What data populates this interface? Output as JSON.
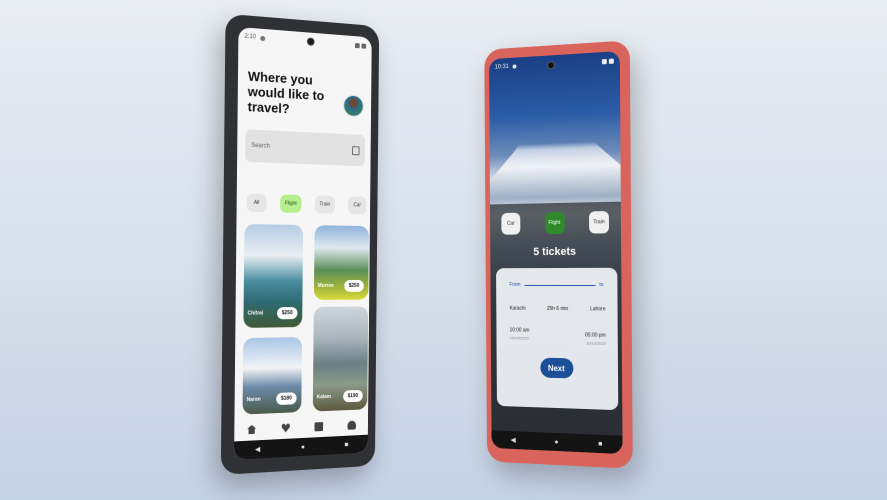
{
  "phone1": {
    "status": {
      "time": "2:10"
    },
    "title": "Where you would like to travel?",
    "search": {
      "placeholder": "Search"
    },
    "categories": [
      {
        "label": "All"
      },
      {
        "label": "Flight",
        "active": true
      },
      {
        "label": "Train"
      },
      {
        "label": "Car"
      }
    ],
    "destinations": [
      {
        "name": "Chitral",
        "price": "$250"
      },
      {
        "name": "Murree",
        "price": "$250"
      },
      {
        "name": "Naran",
        "price": "$180"
      },
      {
        "name": "Kalam",
        "price": "$190"
      }
    ],
    "bottom_nav": [
      "home-icon",
      "heart-icon",
      "ticket-icon",
      "user-icon"
    ],
    "system_nav": {
      "back": "◀",
      "home": "●",
      "recents": "■"
    }
  },
  "phone2": {
    "status": {
      "time": "10:31"
    },
    "categories": [
      {
        "label": "Car"
      },
      {
        "label": "Flight",
        "active": true
      },
      {
        "label": "Train"
      }
    ],
    "tickets_label": "5 tickets",
    "route": {
      "from": "From",
      "to": "to"
    },
    "details": {
      "left": "Karachi",
      "middle": "25h 6 min",
      "right": "Lahore"
    },
    "times": {
      "depart": "10:00 am",
      "depart_sub": "10/10/2023",
      "arrive": "05:00 pm",
      "arrive_sub": "10/10/2023"
    },
    "next_label": "Next",
    "system_nav": {
      "back": "◀",
      "home": "●",
      "recents": "■"
    }
  },
  "colors": {
    "accent_green": "#b6ef8e",
    "flight_green": "#2e8a2a",
    "next_blue": "#1c4f97",
    "phone2_body": "#d9645c"
  }
}
